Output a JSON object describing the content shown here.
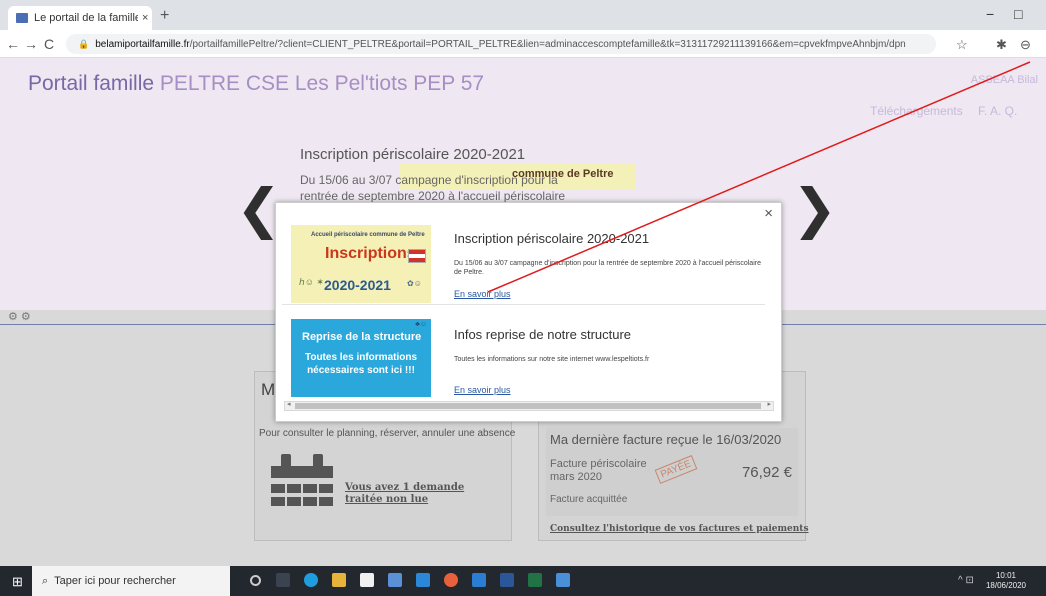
{
  "browser": {
    "tab_title": "Le portail de la famille : votre esp",
    "tab_close": "×",
    "new_tab": "+",
    "url_domain": "belamiportailfamille.fr",
    "url_path": "/portailfamillePeltre/?client=CLIENT_PELTRE&portail=PORTAIL_PELTRE&lien=adminaccescomptefamille&tk=31311729211139166&em=cpvekfmpveAhnbjm/dpn",
    "back": "←",
    "forward": "→",
    "reload": "C",
    "minimize": "−",
    "maximize": "□",
    "star": "☆",
    "puzzle": "✱",
    "profile": "⊖"
  },
  "site": {
    "brand": "Portail famille",
    "brand_sub": "PELTRE CSE Les Pel'tiots PEP 57",
    "user": "ASSEAA Bilal",
    "nav": [
      "Téléchargements",
      "F. A. Q."
    ]
  },
  "carousel": {
    "title": "Inscription périscolaire 2020-2021",
    "text": "Du 15/06 au 3/07 campagne d'inscription pour la rentrée de septembre 2020 à l'accueil périscolaire",
    "image_text": "commune de Peltre",
    "prev": "❮",
    "next": "❯"
  },
  "gears": "⚙ ⚙",
  "card_left": {
    "letter": "M",
    "desc": "Pour consulter le planning, réserver, annuler une absence",
    "demande": "Vous avez 1 demande",
    "demande2": "traitée non lue"
  },
  "invoice": {
    "heading": "Ma dernière facture reçue le 16/03/2020",
    "label": "Facture périscolaire",
    "month": "mars 2020",
    "amount": "76,92 €",
    "stamp": "PAYÉE",
    "status": "Facture acquittée",
    "history": "Consultez l'historique de vos factures et paiements"
  },
  "modal": {
    "close": "×",
    "items": [
      {
        "title": "Inscription périscolaire 2020-2021",
        "desc": "Du 15/06 au 3/07 campagne d'inscription pour la rentrée de septembre 2020 à l'accueil périscolaire de Peltre.",
        "link": "En savoir plus",
        "thumb_small": "Accueil périscolaire commune de Peltre",
        "thumb_big": "Inscriptions",
        "thumb_year": "2020-2021",
        "thumb_kids": "ℎ☺︎ ✶",
        "thumb_kids2": "✿☺︎"
      },
      {
        "title": "Infos reprise de notre structure",
        "desc": "Toutes les informations sur notre site internet www.lespeltiots.fr",
        "link": "En savoir plus",
        "thumb_head": "Reprise de la structure",
        "thumb_body": "Toutes les informations nécessaires sont ici !!!",
        "thumb_logo": "♣☺"
      }
    ]
  },
  "taskbar": {
    "start": "⊞",
    "search_icon": "⌕",
    "search_placeholder": "Taper ici pour rechercher",
    "time": "10:01",
    "date": "18/06/2020",
    "tray": "^ ⊡"
  }
}
